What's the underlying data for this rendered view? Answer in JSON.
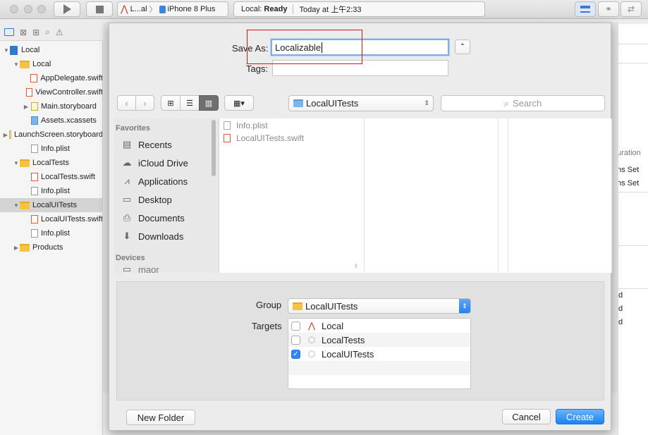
{
  "toolbar": {
    "scheme_app": "L...al",
    "scheme_device": "iPhone 8 Plus",
    "activity_project": "Local:",
    "activity_status": "Ready",
    "activity_time": "Today at 上午2:33",
    "icons": [
      "run-icon",
      "stop-icon",
      "standard-editor-icon",
      "assistant-editor-icon",
      "version-editor-icon"
    ]
  },
  "navigator": {
    "items": [
      {
        "label": "Local",
        "type": "project",
        "indent": 0,
        "expanded": true
      },
      {
        "label": "Local",
        "type": "folder",
        "indent": 1,
        "expanded": true
      },
      {
        "label": "AppDelegate.swift",
        "type": "swift",
        "indent": 2
      },
      {
        "label": "ViewController.swift",
        "type": "swift",
        "indent": 2
      },
      {
        "label": "Main.storyboard",
        "type": "storyboard",
        "indent": 2,
        "collapsed": true
      },
      {
        "label": "Assets.xcassets",
        "type": "xcassets",
        "indent": 2
      },
      {
        "label": "LaunchScreen.storyboard",
        "type": "storyboard",
        "indent": 2,
        "collapsed": true
      },
      {
        "label": "Info.plist",
        "type": "plist",
        "indent": 2
      },
      {
        "label": "LocalTests",
        "type": "folder",
        "indent": 1,
        "expanded": true
      },
      {
        "label": "LocalTests.swift",
        "type": "swift",
        "indent": 2
      },
      {
        "label": "Info.plist",
        "type": "plist",
        "indent": 2
      },
      {
        "label": "LocalUITests",
        "type": "folder",
        "indent": 1,
        "expanded": true,
        "selected": true
      },
      {
        "label": "LocalUITests.swift",
        "type": "swift",
        "indent": 2
      },
      {
        "label": "Info.plist",
        "type": "plist",
        "indent": 2
      },
      {
        "label": "Products",
        "type": "folder",
        "indent": 1,
        "collapsed": true
      }
    ]
  },
  "dialog": {
    "save_as_label": "Save As:",
    "save_as_value": "Localizable",
    "tags_label": "Tags:",
    "tags_value": "",
    "location": "LocalUITests",
    "search_placeholder": "Search",
    "sidebar": {
      "favorites_header": "Favorites",
      "favorites": [
        {
          "label": "Recents",
          "icon": "recents-icon"
        },
        {
          "label": "iCloud Drive",
          "icon": "icloud-icon"
        },
        {
          "label": "Applications",
          "icon": "applications-icon"
        },
        {
          "label": "Desktop",
          "icon": "desktop-icon"
        },
        {
          "label": "Documents",
          "icon": "documents-icon"
        },
        {
          "label": "Downloads",
          "icon": "downloads-icon"
        }
      ],
      "devices_header": "Devices",
      "devices_partial": "maor"
    },
    "files": [
      {
        "label": "Info.plist",
        "type": "plist"
      },
      {
        "label": "LocalUITests.swift",
        "type": "swift"
      }
    ],
    "group_label": "Group",
    "group_value": "LocalUITests",
    "targets_label": "Targets",
    "targets": [
      {
        "label": "Local",
        "checked": false
      },
      {
        "label": "LocalTests",
        "checked": false
      },
      {
        "label": "LocalUITests",
        "checked": true
      }
    ],
    "new_folder": "New Folder",
    "cancel": "Cancel",
    "create": "Create"
  },
  "editor_right": {
    "fragments": [
      "guration",
      "ons Set",
      "ons Set",
      "d",
      "d",
      "d"
    ]
  }
}
